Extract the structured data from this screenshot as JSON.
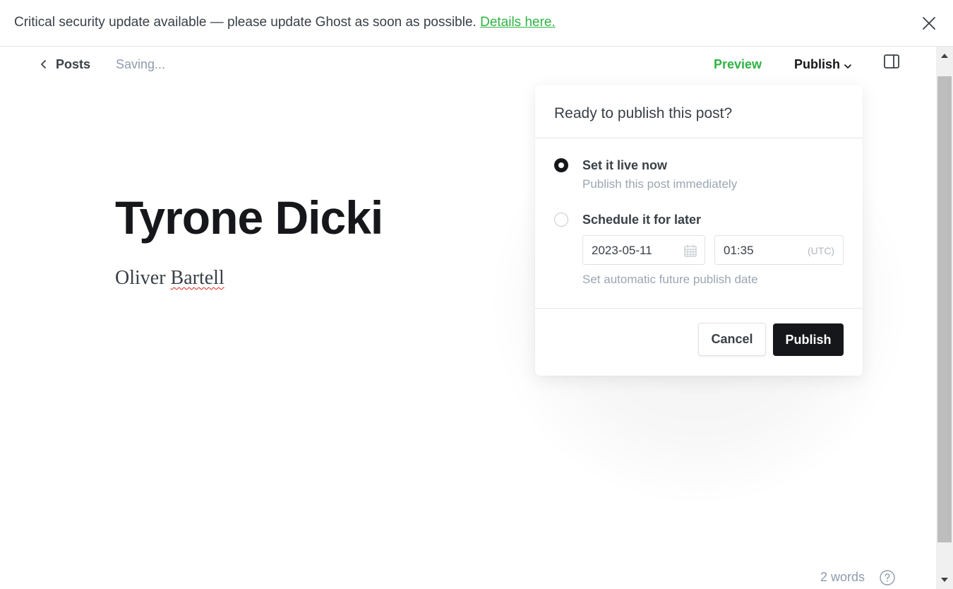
{
  "banner": {
    "message": "Critical security update available — please update Ghost as soon as possible.",
    "link_text": "Details here.",
    "close_icon": "close-icon"
  },
  "header": {
    "back_label": "Posts",
    "back_icon": "chevron-left-icon",
    "status": "Saving...",
    "preview_label": "Preview",
    "publish_label": "Publish",
    "publish_caret_icon": "chevron-down-icon",
    "sidebar_icon": "sidebar-toggle-icon"
  },
  "editor": {
    "title": "Tyrone Dicki",
    "body_first": "Oliver ",
    "body_misspelled": "Bartell",
    "word_count": "2 words",
    "help_icon": "help-circle-icon"
  },
  "publish_popover": {
    "title": "Ready to publish this post?",
    "options": [
      {
        "label": "Set it live now",
        "description": "Publish this post immediately",
        "selected": true
      },
      {
        "label": "Schedule it for later",
        "description": "Set automatic future publish date",
        "selected": false
      }
    ],
    "date_value": "2023-05-11",
    "calendar_icon": "calendar-icon",
    "time_value": "01:35",
    "timezone": "(UTC)",
    "cancel_label": "Cancel",
    "publish_label": "Publish"
  },
  "colors": {
    "accent_green": "#2fb344",
    "primary_dark": "#15171a",
    "muted_text": "#9aa6b2"
  }
}
